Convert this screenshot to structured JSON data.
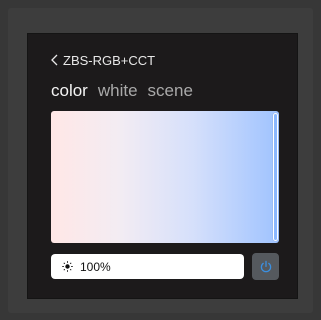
{
  "header": {
    "back_glyph": "<",
    "title": "ZBS-RGB+CCT"
  },
  "tabs": [
    {
      "label": "color",
      "active": true
    },
    {
      "label": "white",
      "active": false
    },
    {
      "label": "scene",
      "active": false
    }
  ],
  "color_panel": {
    "gradient_colors": [
      "#ffe7e6",
      "#f3ecf3",
      "#d6e0fb",
      "#9fc3ff"
    ],
    "selected_position_fraction": 0.98
  },
  "brightness": {
    "value_label": "100%",
    "icon": "sun-icon"
  },
  "power": {
    "icon": "power-icon",
    "color": "#3b8fe0"
  },
  "colors": {
    "background": "#373737",
    "screen": "#1c1a1b",
    "text": "#e8e8e8",
    "tab_inactive": "#a9a9a9"
  }
}
